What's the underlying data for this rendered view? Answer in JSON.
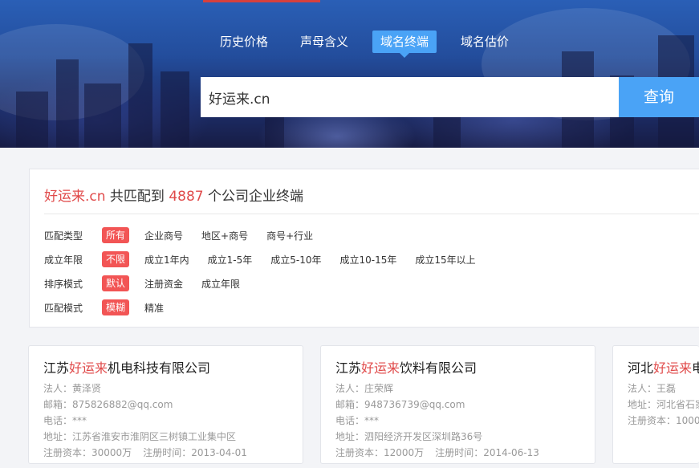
{
  "nav": {
    "tabs": [
      {
        "label": "历史价格"
      },
      {
        "label": "声母含义"
      },
      {
        "label": "域名终端"
      },
      {
        "label": "域名估价"
      }
    ]
  },
  "search": {
    "value": "好运来.cn",
    "button_label": "查询"
  },
  "summary": {
    "domain": "好运来.cn",
    "middle": " 共匹配到 ",
    "count": "4887",
    "suffix": " 个公司企业终端"
  },
  "filters": [
    {
      "label": "匹配类型",
      "options": [
        "所有",
        "企业商号",
        "地区+商号",
        "商号+行业"
      ]
    },
    {
      "label": "成立年限",
      "options": [
        "不限",
        "成立1年内",
        "成立1-5年",
        "成立5-10年",
        "成立10-15年",
        "成立15年以上"
      ]
    },
    {
      "label": "排序模式",
      "options": [
        "默认",
        "注册资金",
        "成立年限"
      ]
    },
    {
      "label": "匹配模式",
      "options": [
        "模糊",
        "精准"
      ]
    }
  ],
  "cards": [
    {
      "name_pre": "江苏",
      "name_hl": "好运来",
      "name_post": "机电科技有限公司",
      "legal": "法人：黄泽贤",
      "email": "邮箱：875826882@qq.com",
      "phone": "电话：***",
      "address": "地址：江苏省淮安市淮阴区三树镇工业集中区",
      "capital": "注册资本：30000万",
      "reg_time": "注册时间：2013-04-01"
    },
    {
      "name_pre": "江苏",
      "name_hl": "好运来",
      "name_post": "饮料有限公司",
      "legal": "法人：庄荣辉",
      "email": "邮箱：948736739@qq.com",
      "phone": "电话：***",
      "address": "地址：泗阳经济开发区深圳路36号",
      "capital": "注册资本：12000万",
      "reg_time": "注册时间：2014-06-13"
    },
    {
      "name_pre": "河北",
      "name_hl": "好运来",
      "name_post": "电",
      "legal": "法人：王磊",
      "address": "地址：河北省石家",
      "capital": "注册资本：1000"
    }
  ],
  "colors": {
    "accent_blue": "#4aa3f6",
    "highlight_red": "#e04a4a",
    "selected_badge": "#f25555"
  }
}
